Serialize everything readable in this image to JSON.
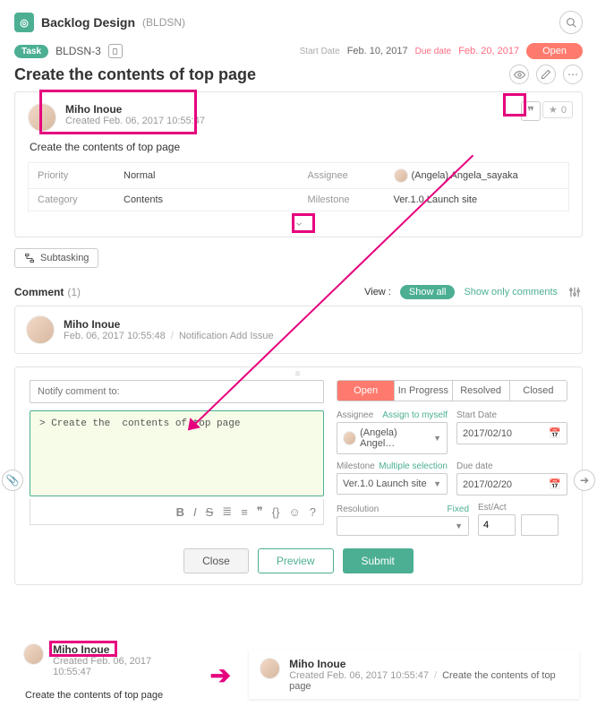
{
  "header": {
    "project_name": "Backlog Design",
    "project_key": "(BLDSN)"
  },
  "meta": {
    "task_badge": "Task",
    "issue_key": "BLDSN-3",
    "start_label": "Start Date",
    "start_value": "Feb. 10, 2017",
    "due_label": "Due date",
    "due_value": "Feb. 20, 2017",
    "status": "Open"
  },
  "issue": {
    "title": "Create the contents of top page",
    "author": "Miho Inoue",
    "created": "Created  Feb. 06, 2017 10:55:47",
    "description": "Create the contents of top page",
    "star_count": "0"
  },
  "props": {
    "priority_label": "Priority",
    "priority_value": "Normal",
    "assignee_label": "Assignee",
    "assignee_value": "(Angela) Angela_sayaka",
    "category_label": "Category",
    "category_value": "Contents",
    "milestone_label": "Milestone",
    "milestone_value": "Ver.1.0 Launch site"
  },
  "subtask_label": "Subtasking",
  "comments": {
    "label": "Comment",
    "count": "(1)",
    "view_label": "View :",
    "show_all": "Show all",
    "show_only": "Show only comments",
    "items": [
      {
        "author": "Miho Inoue",
        "time": "Feb. 06, 2017 10:55:48",
        "note": "Notification Add Issue"
      }
    ]
  },
  "editor": {
    "notify_placeholder": "Notify comment to:",
    "text": "> Create the  contents of top page",
    "status_tabs": {
      "open": "Open",
      "in_progress": "In Progress",
      "resolved": "Resolved",
      "closed": "Closed"
    },
    "fields": {
      "assignee_label": "Assignee",
      "assign_myself": "Assign to myself",
      "assignee_value": "(Angela) Angel…",
      "startdate_label": "Start Date",
      "startdate_value": "2017/02/10",
      "milestone_label": "Milestone",
      "multiple_sel": "Multiple selection",
      "milestone_value": "Ver.1.0 Launch site",
      "duedate_label": "Due date",
      "duedate_value": "2017/02/20",
      "resolution_label": "Resolution",
      "fixed": "Fixed",
      "resolution_value": "",
      "estact_label": "Est/Act",
      "est_value": "4",
      "act_value": ""
    },
    "buttons": {
      "close": "Close",
      "preview": "Preview",
      "submit": "Submit"
    }
  },
  "bottom": {
    "left": {
      "name": "Miho Inoue",
      "created": "Created  Feb. 06, 2017 10:55:47",
      "desc": "Create the contents of top page"
    },
    "right": {
      "name": "Miho Inoue",
      "created": "Created  Feb. 06, 2017 10:55:47",
      "desc": "Create the contents of top page"
    }
  }
}
